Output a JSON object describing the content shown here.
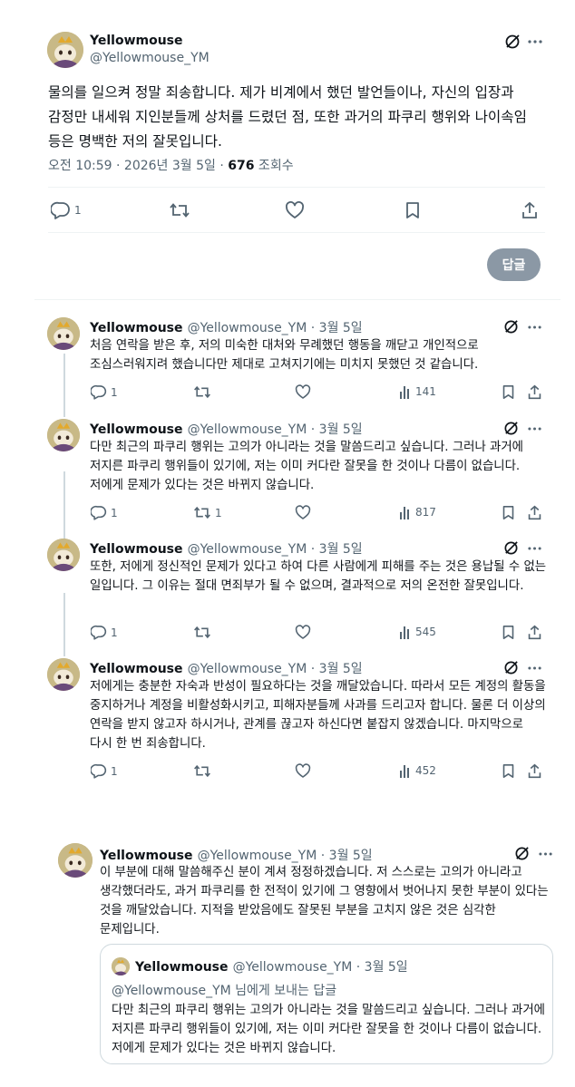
{
  "main_tweet": {
    "name": "Yellowmouse",
    "handle": "@Yellowmouse_YM",
    "text": "물의를 일으켜 정말 죄송합니다. 제가 비계에서 했던 발언들이나, 자신의 입장과 감정만 내세워 지인분들께 상처를 드렸던 점, 또한 과거의 파쿠리 행위와 나이속임 등은 명백한 저의 잘못입니다.",
    "time": "오전 10:59 · 2026년 3월 5일 · ",
    "views_count": "676",
    "views_label": " 조회수",
    "reply_count": "1",
    "reply_button": "답글"
  },
  "thread": [
    {
      "name": "Yellowmouse",
      "handle_date": "@Yellowmouse_YM · 3월 5일",
      "text": "처음 연락을 받은 후, 저의 미숙한 대처와 무례했던 행동을 깨닫고 개인적으로 조심스러워지려 했습니다만 제대로 고쳐지기에는 미치지 못했던 것 같습니다.",
      "replies": "1",
      "retweets": "",
      "views": "141"
    },
    {
      "name": "Yellowmouse",
      "handle_date": "@Yellowmouse_YM · 3월 5일",
      "text": "다만 최근의 파쿠리 행위는 고의가 아니라는 것을 말씀드리고 싶습니다. 그러나 과거에 저지른 파쿠리 행위들이 있기에, 저는 이미 커다란 잘못을 한 것이나 다름이 없습니다. 저에게 문제가 있다는 것은 바뀌지 않습니다.",
      "replies": "1",
      "retweets": "1",
      "views": "817"
    },
    {
      "name": "Yellowmouse",
      "handle_date": "@Yellowmouse_YM · 3월 5일",
      "text": "또한, 저에게 정신적인 문제가 있다고 하여 다른 사람에게 피해를 주는 것은 용납될 수 없는 일입니다. 그 이유는 절대 면죄부가 될 수 없으며, 결과적으로 저의 온전한 잘못입니다.",
      "replies": "1",
      "retweets": "",
      "views": "545"
    },
    {
      "name": "Yellowmouse",
      "handle_date": "@Yellowmouse_YM · 3월 5일",
      "text": "저에게는 충분한 자숙과 반성이 필요하다는 것을 깨달았습니다. 따라서 모든 계정의 활동을 중지하거나 계정을 비활성화시키고, 피해자분들께 사과를 드리고자 합니다. 물론 더 이상의 연락을 받지 않고자 하시거나, 관계를 끊고자 하신다면 붙잡지 않겠습니다. 마지막으로 다시 한 번 죄송합니다.",
      "replies": "1",
      "retweets": "",
      "views": "452"
    }
  ],
  "quote_tweet": {
    "name": "Yellowmouse",
    "handle_date": "@Yellowmouse_YM · 3월 5일",
    "text": "이 부분에 대해 말씀해주신 분이 계셔 정정하겠습니다. 저 스스로는 고의가 아니라고 생각했더라도, 과거 파쿠리를 한 전적이 있기에 그 영향에서 벗어나지 못한 부분이 있다는 것을 깨달았습니다. 지적을 받았음에도 잘못된 부분을 고치지 않은 것은 심각한 문제입니다.",
    "quoted": {
      "name": "Yellowmouse",
      "handle_date": "@Yellowmouse_YM · 3월 5일",
      "reply_to": "@Yellowmouse_YM 님에게 보내는 답글",
      "text": "다만 최근의 파쿠리 행위는 고의가 아니라는 것을 말씀드리고 싶습니다. 그러나 과거에 저지른 파쿠리 행위들이 있기에, 저는 이미 커다란 잘못을 한 것이나 다름이 없습니다. 저에게 문제가 있다는 것은 바뀌지 않습니다."
    }
  },
  "icons": {
    "more": "more-dots-icon",
    "grok": "grok-icon",
    "reply": "reply-icon",
    "retweet": "retweet-icon",
    "like": "like-icon",
    "bookmark": "bookmark-icon",
    "share": "share-icon",
    "views": "views-icon"
  }
}
